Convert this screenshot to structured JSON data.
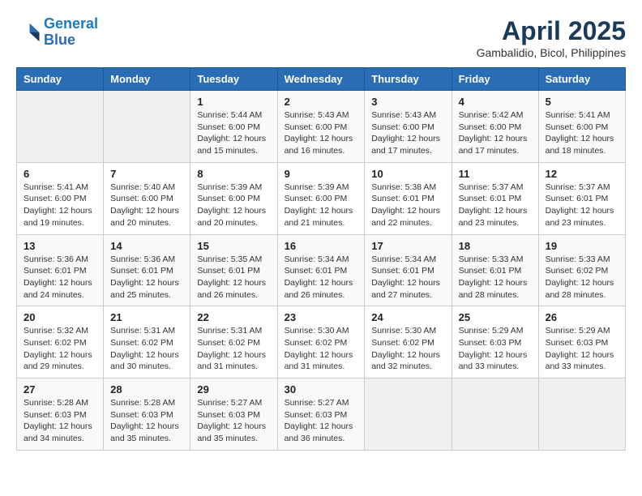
{
  "header": {
    "logo_line1": "General",
    "logo_line2": "Blue",
    "title": "April 2025",
    "subtitle": "Gambalidio, Bicol, Philippines"
  },
  "days_of_week": [
    "Sunday",
    "Monday",
    "Tuesday",
    "Wednesday",
    "Thursday",
    "Friday",
    "Saturday"
  ],
  "weeks": [
    [
      {
        "day": "",
        "info": ""
      },
      {
        "day": "",
        "info": ""
      },
      {
        "day": "1",
        "info": "Sunrise: 5:44 AM\nSunset: 6:00 PM\nDaylight: 12 hours and 15 minutes."
      },
      {
        "day": "2",
        "info": "Sunrise: 5:43 AM\nSunset: 6:00 PM\nDaylight: 12 hours and 16 minutes."
      },
      {
        "day": "3",
        "info": "Sunrise: 5:43 AM\nSunset: 6:00 PM\nDaylight: 12 hours and 17 minutes."
      },
      {
        "day": "4",
        "info": "Sunrise: 5:42 AM\nSunset: 6:00 PM\nDaylight: 12 hours and 17 minutes."
      },
      {
        "day": "5",
        "info": "Sunrise: 5:41 AM\nSunset: 6:00 PM\nDaylight: 12 hours and 18 minutes."
      }
    ],
    [
      {
        "day": "6",
        "info": "Sunrise: 5:41 AM\nSunset: 6:00 PM\nDaylight: 12 hours and 19 minutes."
      },
      {
        "day": "7",
        "info": "Sunrise: 5:40 AM\nSunset: 6:00 PM\nDaylight: 12 hours and 20 minutes."
      },
      {
        "day": "8",
        "info": "Sunrise: 5:39 AM\nSunset: 6:00 PM\nDaylight: 12 hours and 20 minutes."
      },
      {
        "day": "9",
        "info": "Sunrise: 5:39 AM\nSunset: 6:00 PM\nDaylight: 12 hours and 21 minutes."
      },
      {
        "day": "10",
        "info": "Sunrise: 5:38 AM\nSunset: 6:01 PM\nDaylight: 12 hours and 22 minutes."
      },
      {
        "day": "11",
        "info": "Sunrise: 5:37 AM\nSunset: 6:01 PM\nDaylight: 12 hours and 23 minutes."
      },
      {
        "day": "12",
        "info": "Sunrise: 5:37 AM\nSunset: 6:01 PM\nDaylight: 12 hours and 23 minutes."
      }
    ],
    [
      {
        "day": "13",
        "info": "Sunrise: 5:36 AM\nSunset: 6:01 PM\nDaylight: 12 hours and 24 minutes."
      },
      {
        "day": "14",
        "info": "Sunrise: 5:36 AM\nSunset: 6:01 PM\nDaylight: 12 hours and 25 minutes."
      },
      {
        "day": "15",
        "info": "Sunrise: 5:35 AM\nSunset: 6:01 PM\nDaylight: 12 hours and 26 minutes."
      },
      {
        "day": "16",
        "info": "Sunrise: 5:34 AM\nSunset: 6:01 PM\nDaylight: 12 hours and 26 minutes."
      },
      {
        "day": "17",
        "info": "Sunrise: 5:34 AM\nSunset: 6:01 PM\nDaylight: 12 hours and 27 minutes."
      },
      {
        "day": "18",
        "info": "Sunrise: 5:33 AM\nSunset: 6:01 PM\nDaylight: 12 hours and 28 minutes."
      },
      {
        "day": "19",
        "info": "Sunrise: 5:33 AM\nSunset: 6:02 PM\nDaylight: 12 hours and 28 minutes."
      }
    ],
    [
      {
        "day": "20",
        "info": "Sunrise: 5:32 AM\nSunset: 6:02 PM\nDaylight: 12 hours and 29 minutes."
      },
      {
        "day": "21",
        "info": "Sunrise: 5:31 AM\nSunset: 6:02 PM\nDaylight: 12 hours and 30 minutes."
      },
      {
        "day": "22",
        "info": "Sunrise: 5:31 AM\nSunset: 6:02 PM\nDaylight: 12 hours and 31 minutes."
      },
      {
        "day": "23",
        "info": "Sunrise: 5:30 AM\nSunset: 6:02 PM\nDaylight: 12 hours and 31 minutes."
      },
      {
        "day": "24",
        "info": "Sunrise: 5:30 AM\nSunset: 6:02 PM\nDaylight: 12 hours and 32 minutes."
      },
      {
        "day": "25",
        "info": "Sunrise: 5:29 AM\nSunset: 6:03 PM\nDaylight: 12 hours and 33 minutes."
      },
      {
        "day": "26",
        "info": "Sunrise: 5:29 AM\nSunset: 6:03 PM\nDaylight: 12 hours and 33 minutes."
      }
    ],
    [
      {
        "day": "27",
        "info": "Sunrise: 5:28 AM\nSunset: 6:03 PM\nDaylight: 12 hours and 34 minutes."
      },
      {
        "day": "28",
        "info": "Sunrise: 5:28 AM\nSunset: 6:03 PM\nDaylight: 12 hours and 35 minutes."
      },
      {
        "day": "29",
        "info": "Sunrise: 5:27 AM\nSunset: 6:03 PM\nDaylight: 12 hours and 35 minutes."
      },
      {
        "day": "30",
        "info": "Sunrise: 5:27 AM\nSunset: 6:03 PM\nDaylight: 12 hours and 36 minutes."
      },
      {
        "day": "",
        "info": ""
      },
      {
        "day": "",
        "info": ""
      },
      {
        "day": "",
        "info": ""
      }
    ]
  ]
}
